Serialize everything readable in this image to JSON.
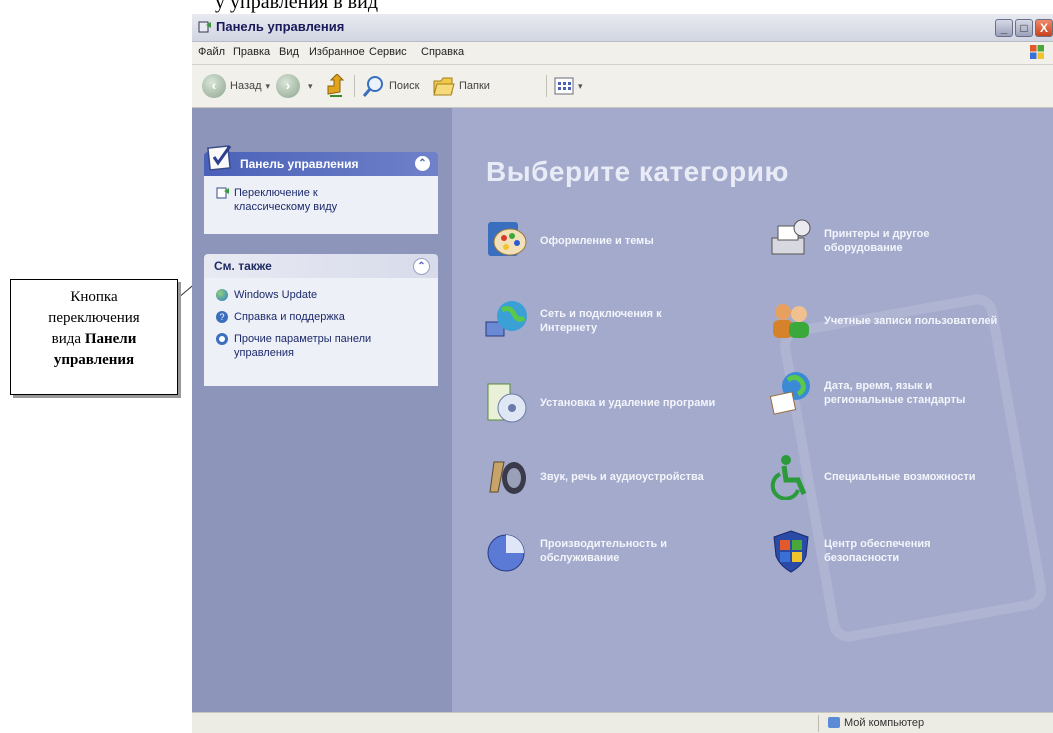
{
  "page_top_text": "у управления в вид",
  "callout": {
    "line1": "Кнопка",
    "line2": "переключения",
    "line3_prefix": "вида ",
    "line3_bold": "Панели",
    "line4_bold": "управления"
  },
  "window": {
    "title": "Панель управления",
    "buttons": {
      "minimize": "_",
      "maximize": "□",
      "close": "X"
    }
  },
  "menu": [
    "Файл",
    "Правка",
    "Вид",
    "Избранное",
    "Сервис",
    "Справка"
  ],
  "toolbar": {
    "back_label": "Назад",
    "search_label": "Поиск",
    "folders_label": "Папки"
  },
  "sidebar": {
    "panel1": {
      "title": "Панель управления",
      "link_line1": "Переключение к",
      "link_line2": "классическому виду"
    },
    "panel2": {
      "title": "См. также",
      "items": [
        "Windows Update",
        "Справка и поддержка"
      ],
      "item3_line1": "Прочие параметры панели",
      "item3_line2": "управления"
    }
  },
  "main": {
    "heading": "Выберите категорию",
    "categories": [
      {
        "line1": "Оформление и темы",
        "line2": ""
      },
      {
        "line1": "Принтеры и другое",
        "line2": "оборудование"
      },
      {
        "line1": "Сеть и подключения к",
        "line2": "Интернету"
      },
      {
        "line1": "Учетные записи пользователей",
        "line2": ""
      },
      {
        "line1": "Установка и удаление програми",
        "line2": ""
      },
      {
        "line1": "Дата, время, язык и",
        "line2": "региональные стандарты"
      },
      {
        "line1": "Звук, речь и аудиоустройства",
        "line2": ""
      },
      {
        "line1": "Специальные возможности",
        "line2": ""
      },
      {
        "line1": "Производительность и",
        "line2": "обслуживание"
      },
      {
        "line1": "Центр обеспечения",
        "line2": "безопасности"
      }
    ]
  },
  "status": {
    "my_computer": "Мой компьютер"
  },
  "colors": {
    "content_bg": "#A3AACB",
    "sidebar_bg": "#8D95BB",
    "panel_head": "#4a61b8"
  }
}
